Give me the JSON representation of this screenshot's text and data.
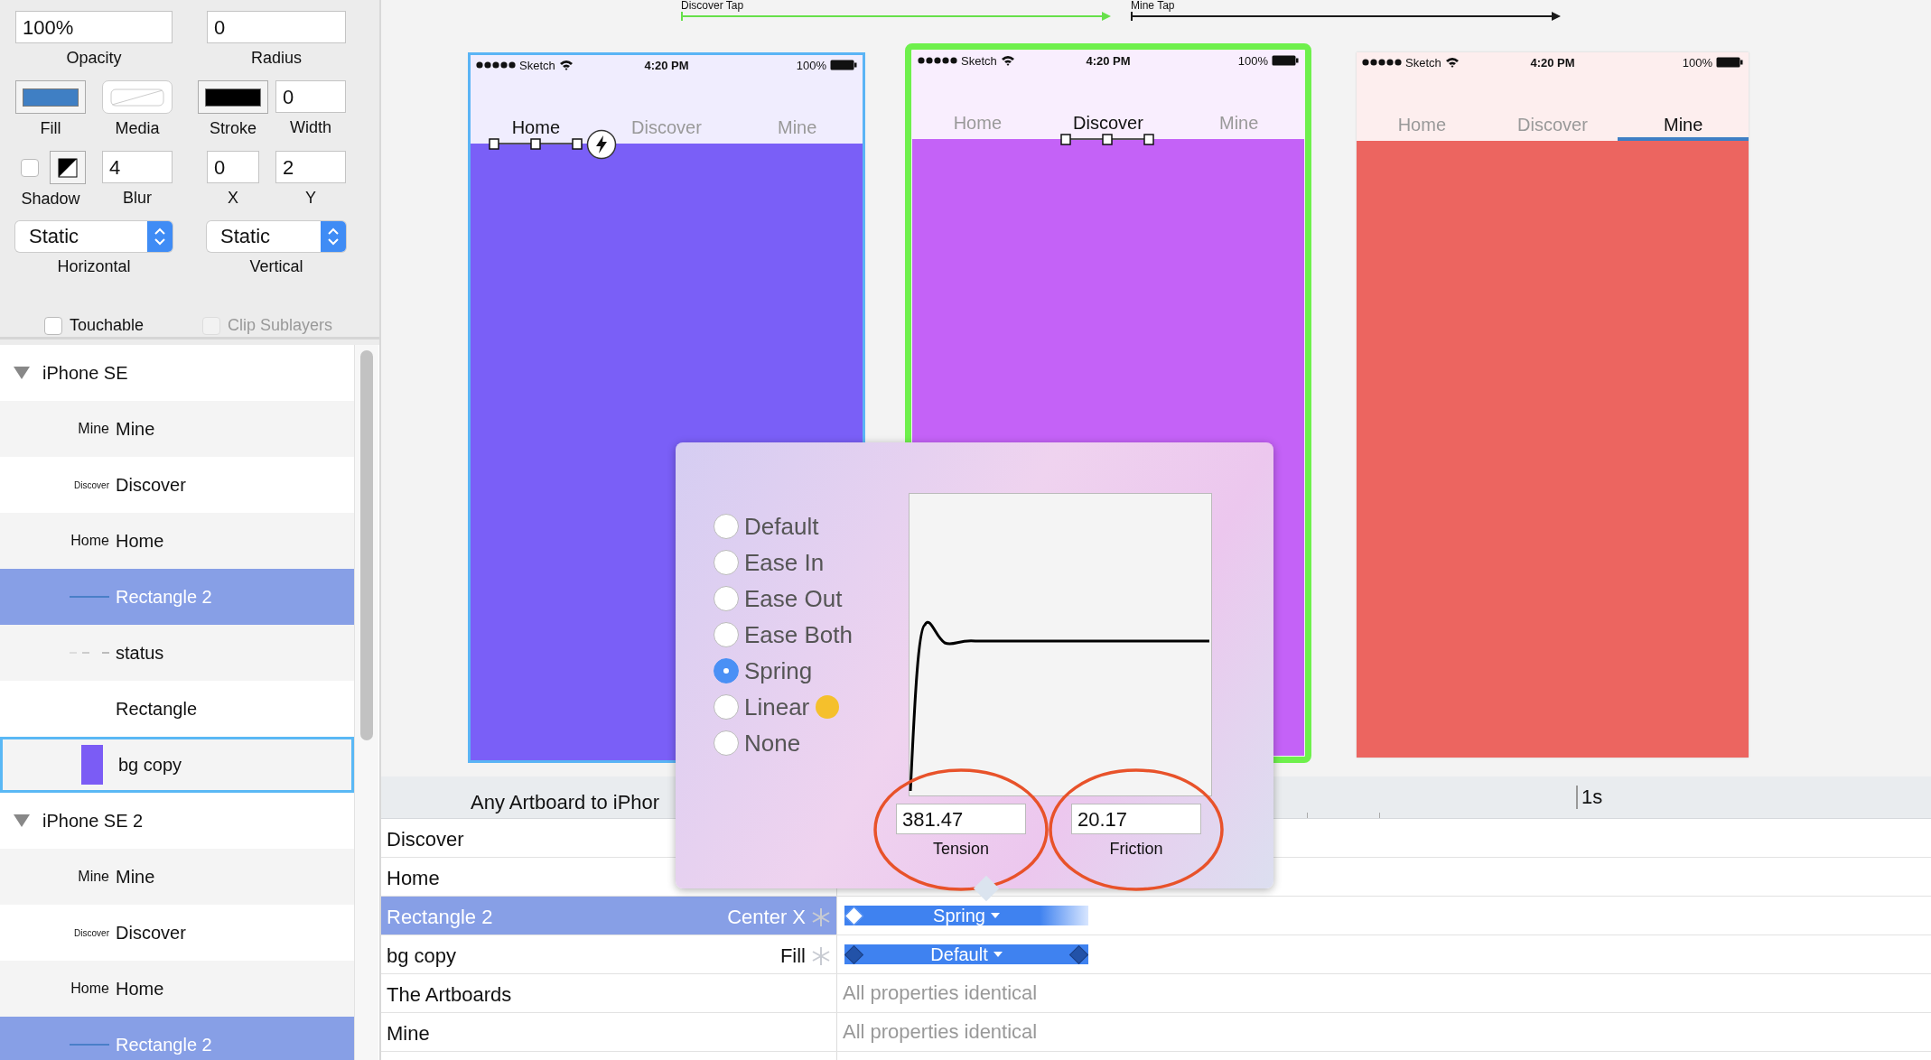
{
  "transitions": [
    {
      "label": "Discover Tap",
      "color": "#66e04a"
    },
    {
      "label": "Mine Tap",
      "color": "#1a1a1a"
    }
  ],
  "inspector": {
    "opacity": {
      "label": "Opacity",
      "value": "100%"
    },
    "radius": {
      "label": "Radius",
      "value": "0"
    },
    "fill": {
      "label": "Fill",
      "color": "#3f7fc4"
    },
    "media": {
      "label": "Media"
    },
    "stroke": {
      "label": "Stroke",
      "color": "#000000"
    },
    "width": {
      "label": "Width",
      "value": "0"
    },
    "shadow": {
      "label": "Shadow",
      "checked": false
    },
    "blur": {
      "label": "Blur",
      "value": "4"
    },
    "x": {
      "label": "X",
      "value": "0"
    },
    "y": {
      "label": "Y",
      "value": "2"
    },
    "horizontal": {
      "label": "Horizontal",
      "value": "Static"
    },
    "vertical": {
      "label": "Vertical",
      "value": "Static"
    },
    "touchable": {
      "label": "Touchable",
      "checked": false,
      "disabled": false
    },
    "clip": {
      "label": "Clip Sublayers",
      "checked": false,
      "disabled": true
    }
  },
  "layers": [
    {
      "name": "iPhone SE",
      "expanded": true,
      "selected": false,
      "children": [
        {
          "name": "Mine",
          "kind": "text",
          "thumb": "Mine",
          "selected": false,
          "focused": false
        },
        {
          "name": "Discover",
          "kind": "text",
          "thumb": "Discover",
          "selected": false,
          "focused": false
        },
        {
          "name": "Home",
          "kind": "text",
          "thumb": "Home",
          "selected": false,
          "focused": false
        },
        {
          "name": "Rectangle 2",
          "kind": "line",
          "selected": true,
          "focused": false
        },
        {
          "name": "status",
          "kind": "dashes",
          "selected": false,
          "focused": false
        },
        {
          "name": "Rectangle",
          "kind": "none",
          "selected": false,
          "focused": false
        },
        {
          "name": "bg copy",
          "kind": "swatch",
          "color": "#7b5cf5",
          "selected": false,
          "focused": true
        }
      ]
    },
    {
      "name": "iPhone SE 2",
      "expanded": true,
      "selected": false,
      "children": [
        {
          "name": "Mine",
          "kind": "text",
          "thumb": "Mine",
          "selected": false,
          "focused": false
        },
        {
          "name": "Discover",
          "kind": "text",
          "thumb": "Discover",
          "selected": false,
          "focused": false
        },
        {
          "name": "Home",
          "kind": "text",
          "thumb": "Home",
          "selected": false,
          "focused": false
        },
        {
          "name": "Rectangle 2",
          "kind": "line",
          "selected": true,
          "focused": false
        }
      ]
    }
  ],
  "artboards": [
    {
      "carrier": "Sketch",
      "time": "4:20 PM",
      "battery": "100%",
      "hovered": true,
      "selected": false,
      "color": "#7a5ff7",
      "kind": "handles",
      "trigger": true,
      "tabs": [
        {
          "label": "Home",
          "selected": true
        },
        {
          "label": "Discover",
          "selected": false
        },
        {
          "label": "Mine",
          "selected": false
        }
      ]
    },
    {
      "carrier": "Sketch",
      "time": "4:20 PM",
      "battery": "100%",
      "hovered": false,
      "selected": true,
      "color": "#c462f7",
      "kind": "handles",
      "trigger": false,
      "tabs": [
        {
          "label": "Home",
          "selected": false
        },
        {
          "label": "Discover",
          "selected": true
        },
        {
          "label": "Mine",
          "selected": false
        }
      ]
    },
    {
      "carrier": "Sketch",
      "time": "4:20 PM",
      "battery": "100%",
      "hovered": false,
      "selected": false,
      "color": "#ec6560",
      "kind": "underline",
      "trigger": false,
      "tabs": [
        {
          "label": "Home",
          "selected": false
        },
        {
          "label": "Discover",
          "selected": false
        },
        {
          "label": "Mine",
          "selected": true
        }
      ]
    }
  ],
  "popup": {
    "curves": [
      {
        "label": "Default",
        "selected": false
      },
      {
        "label": "Ease In",
        "selected": false
      },
      {
        "label": "Ease Out",
        "selected": false
      },
      {
        "label": "Ease Both",
        "selected": false
      },
      {
        "label": "Spring",
        "selected": true
      },
      {
        "label": "Linear",
        "selected": false,
        "emoji": true
      },
      {
        "label": "None",
        "selected": false
      }
    ],
    "tension": {
      "label": "Tension",
      "value": "381.47",
      "circled": true
    },
    "friction": {
      "label": "Friction",
      "value": "20.17",
      "circled": true
    }
  },
  "timeline": {
    "title": "Any Artboard to iPhor",
    "tick": "1s",
    "rows": [
      {
        "name": "Discover",
        "selected": false
      },
      {
        "name": "Home",
        "selected": false
      },
      {
        "name": "Rectangle 2",
        "selected": true,
        "property": "Center X",
        "track": {
          "label": "Spring",
          "start_selected": true,
          "end_keyframe": false
        }
      },
      {
        "name": "bg copy",
        "selected": false,
        "property": "Fill",
        "track": {
          "label": "Default",
          "start_selected": false,
          "end_keyframe": true
        }
      },
      {
        "name": "The Artboards",
        "selected": false,
        "note": "All properties identical"
      },
      {
        "name": "Mine",
        "selected": false,
        "note": "All properties identical"
      }
    ]
  }
}
